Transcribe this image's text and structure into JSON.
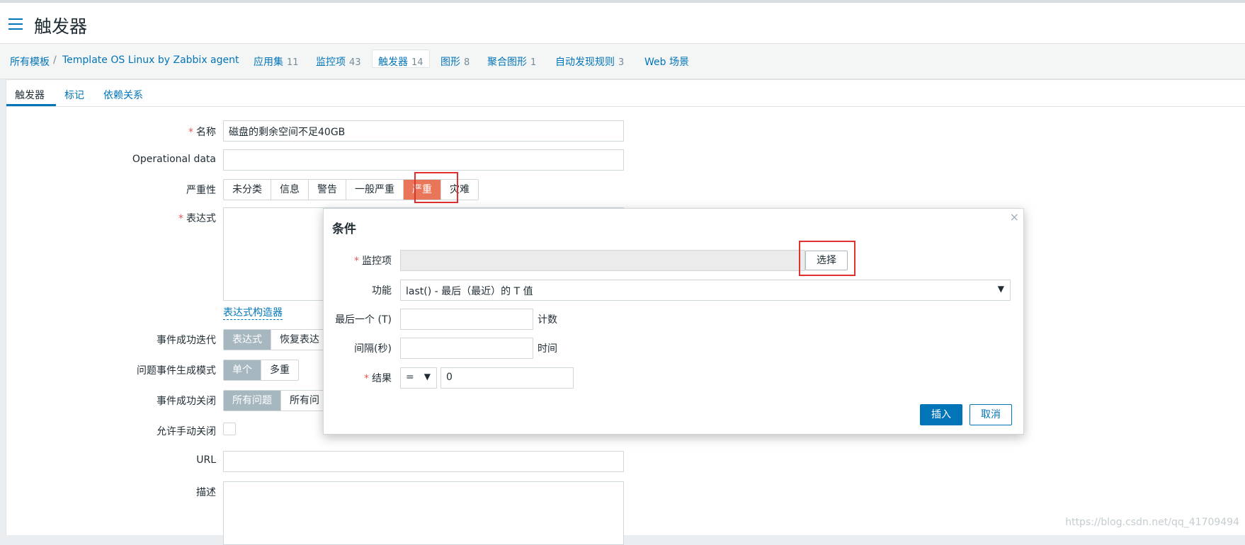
{
  "header": {
    "title": "触发器"
  },
  "breadcrumb": {
    "all_templates": "所有模板",
    "separator": "/",
    "template_name": "Template OS Linux by Zabbix agent",
    "items": [
      {
        "label": "应用集",
        "count": "11"
      },
      {
        "label": "监控项",
        "count": "43"
      },
      {
        "label": "触发器",
        "count": "14"
      },
      {
        "label": "图形",
        "count": "8"
      },
      {
        "label": "聚合图形",
        "count": "1"
      },
      {
        "label": "自动发现规则",
        "count": "3"
      },
      {
        "label": "Web 场景",
        "count": ""
      }
    ]
  },
  "tabs": [
    "触发器",
    "标记",
    "依赖关系"
  ],
  "form": {
    "name_label": "名称",
    "name_value": "磁盘的剩余空间不足40GB",
    "opdata_label": "Operational data",
    "severity_label": "严重性",
    "severity_options": [
      "未分类",
      "信息",
      "警告",
      "一般严重",
      "严重",
      "灾难"
    ],
    "severity_selected": "严重",
    "expression_label": "表达式",
    "expression_builder": "表达式构造器",
    "ok_event_label": "事件成功迭代",
    "ok_event_options": [
      "表达式",
      "恢复表达"
    ],
    "problem_mode_label": "问题事件生成模式",
    "problem_mode_options": [
      "单个",
      "多重"
    ],
    "ok_close_label": "事件成功关闭",
    "ok_close_options": [
      "所有问题",
      "所有问"
    ],
    "manual_close_label": "允许手动关闭",
    "url_label": "URL",
    "desc_label": "描述"
  },
  "dialog": {
    "title": "条件",
    "close": "×",
    "item_label": "监控项",
    "item_value": "",
    "select_button": "选择",
    "function_label": "功能",
    "function_value": "last() - 最后（最近）的 T 值",
    "last_label": "最后一个 (T)",
    "last_suffix": "计数",
    "interval_label": "间隔(秒)",
    "interval_suffix": "时间",
    "result_label": "结果",
    "result_operator": "=",
    "result_value": "0",
    "insert_button": "插入",
    "cancel_button": "取消"
  },
  "watermark": "https://blog.csdn.net/qq_41709494",
  "colors": {
    "accent": "#0275b8",
    "severity_high": "#e97659",
    "highlight_box": "#e03030"
  }
}
